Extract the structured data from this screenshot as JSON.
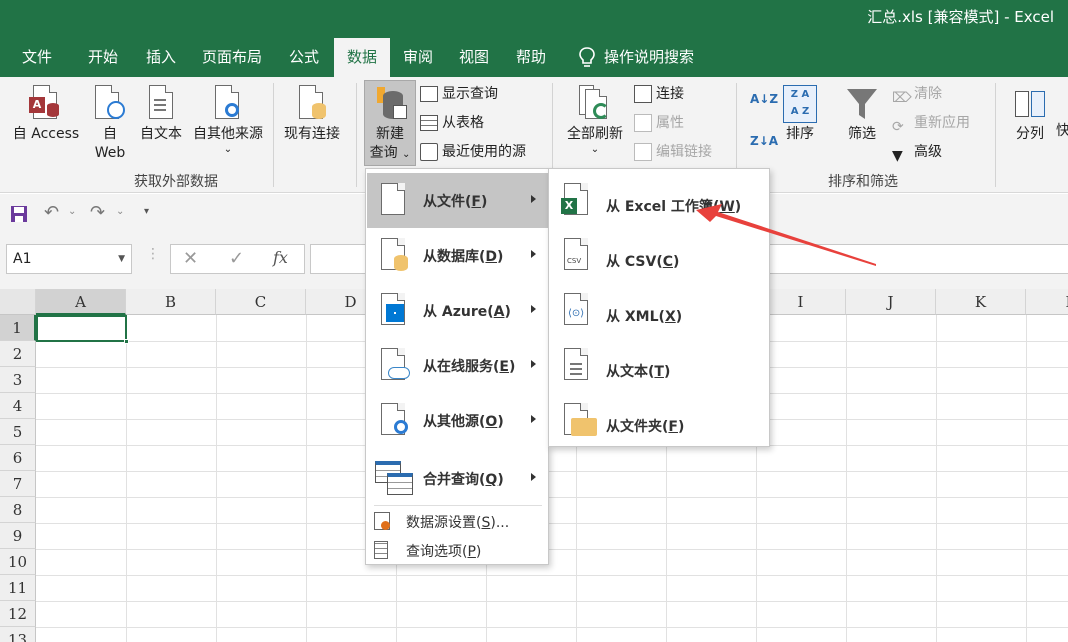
{
  "window": {
    "title": "汇总.xls  [兼容模式]  -  Excel"
  },
  "tabs": [
    {
      "label": "文件"
    },
    {
      "label": "开始"
    },
    {
      "label": "插入"
    },
    {
      "label": "页面布局"
    },
    {
      "label": "公式"
    },
    {
      "label": "数据"
    },
    {
      "label": "审阅"
    },
    {
      "label": "视图"
    },
    {
      "label": "帮助"
    }
  ],
  "tell_me": "操作说明搜索",
  "ribbon": {
    "get_external": {
      "access": "自 Access",
      "web_line1": "自",
      "web_line2": "Web",
      "text": "自文本",
      "other": "自其他来源",
      "existing": "现有连接",
      "group_label": "获取外部数据"
    },
    "transform": {
      "new_query_line1": "新建",
      "new_query_line2": "查询",
      "show_queries": "显示查询",
      "from_table": "从表格",
      "recent_sources": "最近使用的源"
    },
    "connections": {
      "refresh_all": "全部刷新",
      "connections": "连接",
      "properties": "属性",
      "edit_links": "编辑链接"
    },
    "sort_filter": {
      "sort": "排序",
      "filter": "筛选",
      "clear": "清除",
      "reapply": "重新应用",
      "advanced": "高级",
      "group_label": "排序和筛选"
    },
    "data_tools": {
      "split": "分列",
      "partial": "快"
    }
  },
  "name_box": {
    "value": "A1"
  },
  "grid": {
    "columns": [
      "A",
      "B",
      "C",
      "D",
      "E",
      "F",
      "G",
      "H",
      "I",
      "J",
      "K",
      "L"
    ],
    "rows": [
      "1",
      "2",
      "3",
      "4",
      "5",
      "6",
      "7",
      "8",
      "9",
      "10",
      "11",
      "12",
      "13"
    ]
  },
  "menu_new_query": {
    "items": [
      {
        "label": "从文件",
        "key": "F"
      },
      {
        "label": "从数据库",
        "key": "D"
      },
      {
        "label": "从 Azure",
        "key": "A"
      },
      {
        "label": "从在线服务",
        "key": "E"
      },
      {
        "label": "从其他源",
        "key": "O"
      },
      {
        "label": "合并查询",
        "key": "Q"
      }
    ],
    "small_items": [
      {
        "label": "数据源设置",
        "key": "S",
        "suffix": "..."
      },
      {
        "label": "查询选项",
        "key": "P",
        "suffix": ""
      }
    ]
  },
  "menu_from_file": {
    "items": [
      {
        "label": "从 Excel 工作簿",
        "key": "W"
      },
      {
        "label": "从 CSV",
        "key": "C"
      },
      {
        "label": "从 XML",
        "key": "X"
      },
      {
        "label": "从文本",
        "key": "T"
      },
      {
        "label": "从文件夹",
        "key": "F"
      }
    ]
  },
  "colors": {
    "excel_green": "#217346",
    "annotation_red": "#e8413c",
    "menu_highlight": "#c5c5c5"
  }
}
